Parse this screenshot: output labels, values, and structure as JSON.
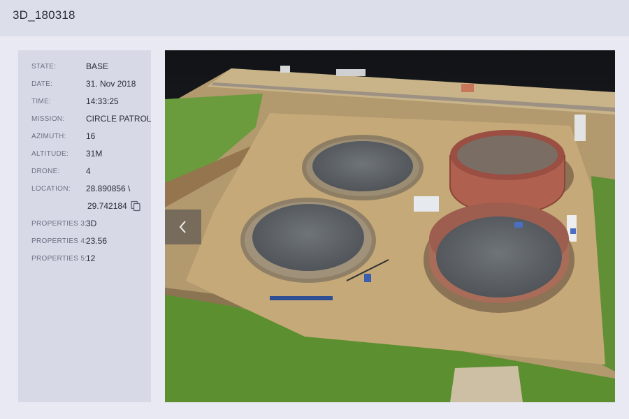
{
  "header": {
    "title": "3D_180318"
  },
  "info": {
    "state": {
      "label": "STATE:",
      "value": "BASE"
    },
    "date": {
      "label": "DATE:",
      "value": "31. Nov 2018"
    },
    "time": {
      "label": "TIME:",
      "value": "14:33:25"
    },
    "mission": {
      "label": "MISSION:",
      "value": "CIRCLE PATROL"
    },
    "azimuth": {
      "label": "AZIMUTH:",
      "value": "16"
    },
    "altitude": {
      "label": "ALTITUDE:",
      "value": "31M"
    },
    "drone": {
      "label": "DRONE:",
      "value": "4"
    },
    "location": {
      "label": "LOCATION:",
      "value_line1": "28.890856 \\",
      "value_line2": "29.742184"
    },
    "properties3": {
      "label": "PROPERTIES 3:",
      "value": "3D"
    },
    "properties4": {
      "label": "PROPERTIES 4:",
      "value": "23.56"
    },
    "properties5": {
      "label": "PROPERTIES 5:",
      "value": "12"
    }
  },
  "icons": {
    "copy": "copy-icon",
    "prev": "chevron-left-icon"
  },
  "colors": {
    "header_bg": "#dcdeea",
    "panel_bg": "#d7d9e6",
    "page_bg": "#e9e9f3",
    "viewer_bg": "#1e1f22"
  }
}
